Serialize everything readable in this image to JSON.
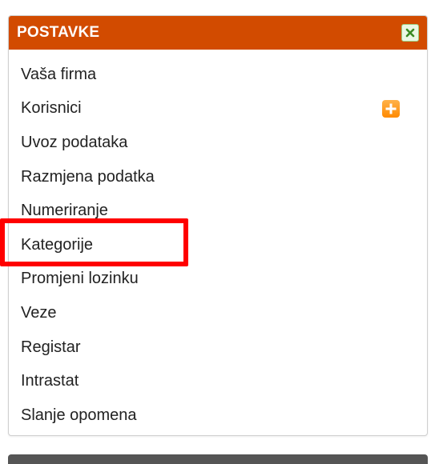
{
  "panel": {
    "title": "POSTAVKE",
    "header_color": "#d24b00",
    "close_icon": "close-icon"
  },
  "menu": {
    "items": [
      {
        "label": "Vaša firma"
      },
      {
        "label": "Korisnici",
        "icon": "add-icon"
      },
      {
        "label": "Uvoz podataka"
      },
      {
        "label": "Razmjena podatka"
      },
      {
        "label": "Numeriranje"
      },
      {
        "label": "Kategorije",
        "highlighted": true
      },
      {
        "label": "Promjeni lozinku"
      },
      {
        "label": "Veze"
      },
      {
        "label": "Registar"
      },
      {
        "label": "Intrastat"
      },
      {
        "label": "Slanje opomena"
      }
    ]
  },
  "highlight_color": "#ff0000"
}
